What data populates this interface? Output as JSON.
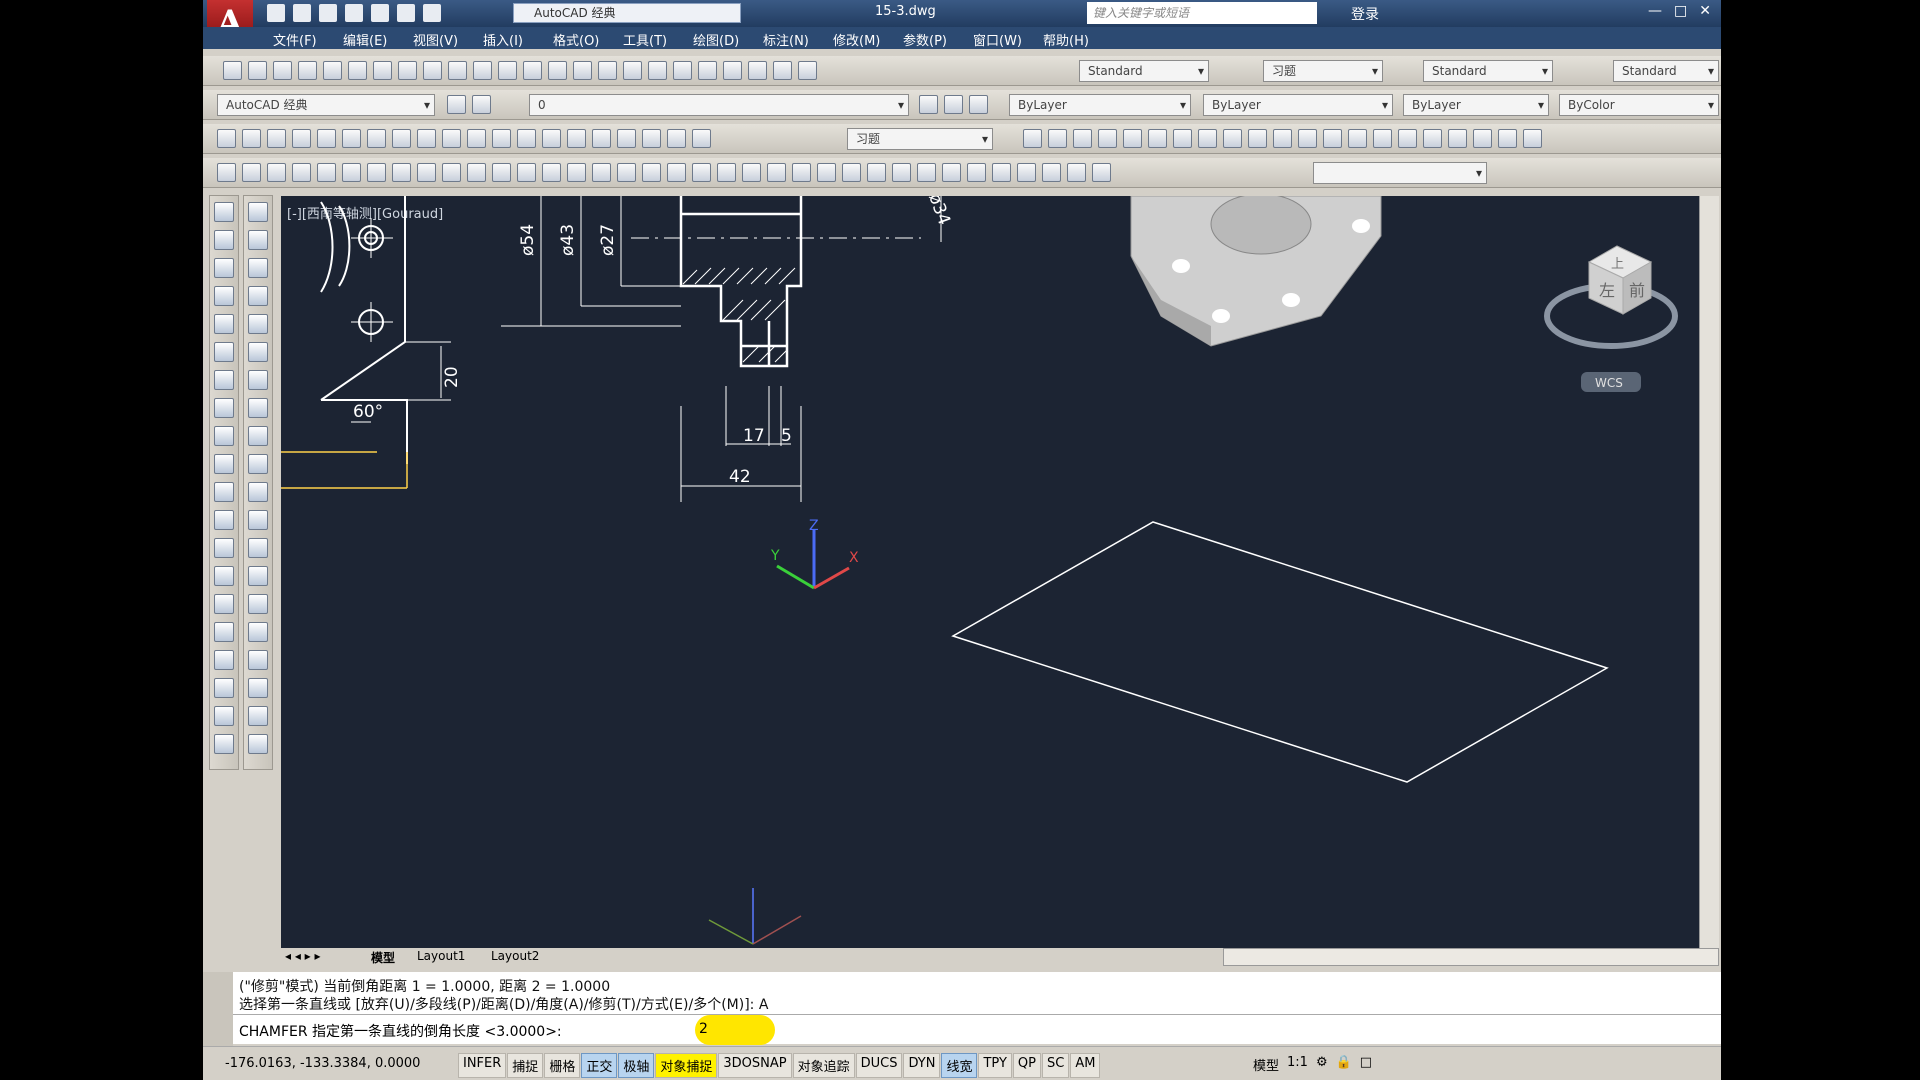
{
  "title": {
    "workspace_combo": "AutoCAD 经典",
    "filename": "15-3.dwg",
    "search_placeholder": "键入关键字或短语",
    "login": "登录"
  },
  "menu": [
    "文件(F)",
    "编辑(E)",
    "视图(V)",
    "插入(I)",
    "格式(O)",
    "工具(T)",
    "绘图(D)",
    "标注(N)",
    "修改(M)",
    "参数(P)",
    "窗口(W)",
    "帮助(H)"
  ],
  "toolbar1": {
    "text_style": "Standard",
    "dim_style": "习题",
    "table_style": "Standard",
    "ml_style": "Standard"
  },
  "toolbar2": {
    "workspace": "AutoCAD 经典",
    "layer": "0",
    "color": "ByLayer",
    "linetype": "ByLayer",
    "lineweight": "ByLayer",
    "plotstyle": "ByColor"
  },
  "toolbar3": {
    "dim_style": "习题"
  },
  "viewport_label": "[-][西南等轴测][Gouraud]",
  "drawing": {
    "dims": [
      "ø54",
      "ø43",
      "ø27",
      "ø34",
      "60°",
      "20",
      "17",
      "5",
      "42"
    ]
  },
  "viewcube": {
    "faces": [
      "上",
      "左",
      "前"
    ],
    "wcs": "WCS"
  },
  "tabs": [
    "模型",
    "Layout1",
    "Layout2"
  ],
  "command": {
    "line1": "(\"修剪\"模式) 当前倒角距离 1 = 1.0000, 距离 2 = 1.0000",
    "line2": "选择第一条直线或 [放弃(U)/多段线(P)/距离(D)/角度(A)/修剪(T)/方式(E)/多个(M)]: A",
    "prompt": "CHAMFER 指定第一条直线的倒角长度 <3.0000>: ",
    "input": "2"
  },
  "status": {
    "coords": "-176.0163, -133.3384, 0.0000",
    "buttons": [
      "INFER",
      "捕捉",
      "栅格",
      "正交",
      "极轴",
      "对象捕捉",
      "3DOSNAP",
      "对象追踪",
      "DUCS",
      "DYN",
      "线宽",
      "TPY",
      "QP",
      "SC",
      "AM"
    ],
    "on_buttons": [
      "正交",
      "极轴",
      "对象捕捉",
      "线宽"
    ],
    "highlighted": "对象捕捉",
    "model_label": "模型",
    "scale": "1:1"
  }
}
